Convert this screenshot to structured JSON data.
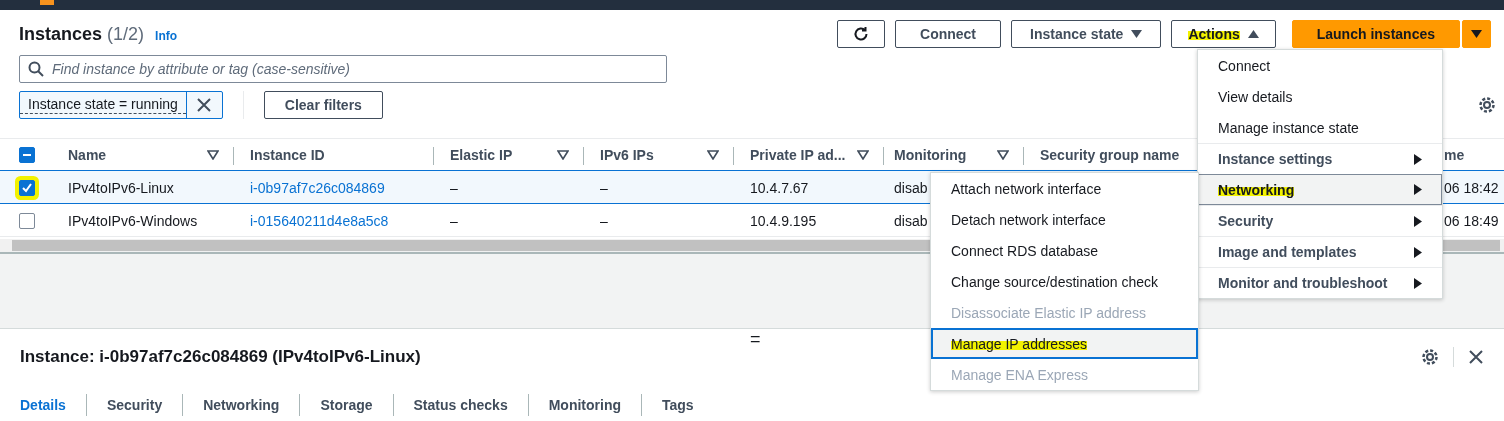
{
  "header": {
    "title": "Instances",
    "count": "(1/2)",
    "info": "Info"
  },
  "toolbar": {
    "connect": "Connect",
    "instance_state": "Instance state",
    "actions": {
      "label": "Actions",
      "expanded": true,
      "highlighted": true
    },
    "launch": "Launch instances"
  },
  "search": {
    "placeholder": "Find instance by attribute or tag (case-sensitive)"
  },
  "filter": {
    "token": "Instance state = running"
  },
  "clear_filters": "Clear filters",
  "table": {
    "select_all": {
      "indeterminate": true
    },
    "columns": [
      {
        "label": "Name",
        "filter_icon": true,
        "kind": "text"
      },
      {
        "label": "Instance ID",
        "filter_icon": false,
        "kind": "link"
      },
      {
        "label": "Elastic IP",
        "filter_icon": true,
        "kind": "text"
      },
      {
        "label": "IPv6 IPs",
        "filter_icon": true,
        "kind": "text"
      },
      {
        "label": "Private IP ad...",
        "filter_icon": true,
        "kind": "text"
      },
      {
        "label": "Monitoring",
        "filter_icon": true,
        "kind": "text"
      },
      {
        "label": "Security group name",
        "filter_icon": false,
        "kind": "covered"
      },
      {
        "label": "me",
        "filter_icon": false,
        "kind": "text"
      }
    ],
    "rows": [
      {
        "selected": true,
        "highlighted": true,
        "cells": [
          "IPv4toIPv6-Linux",
          "i-0b97af7c26c084869",
          "–",
          "–",
          "10.4.7.67",
          "disab",
          "06 18:42"
        ]
      },
      {
        "selected": false,
        "highlighted": false,
        "cells": [
          "IPv4toIPv6-Windows",
          "i-015640211d4e8a5c8",
          "–",
          "–",
          "10.4.9.195",
          "disab",
          "06 18:49"
        ]
      }
    ]
  },
  "actions_menu": [
    {
      "label": "Connect",
      "kind": "action",
      "selected": false,
      "highlighted": false
    },
    {
      "label": "View details",
      "kind": "action",
      "selected": false,
      "highlighted": false
    },
    {
      "label": "Manage instance state",
      "kind": "action",
      "selected": false,
      "highlighted": false
    },
    {
      "label": "Instance settings",
      "kind": "submenu",
      "selected": false,
      "highlighted": false
    },
    {
      "label": "Networking",
      "kind": "submenu",
      "selected": true,
      "highlighted": true
    },
    {
      "label": "Security",
      "kind": "submenu",
      "selected": false,
      "highlighted": false
    },
    {
      "label": "Image and templates",
      "kind": "submenu",
      "selected": false,
      "highlighted": false
    },
    {
      "label": "Monitor and troubleshoot",
      "kind": "submenu",
      "selected": false,
      "highlighted": false
    }
  ],
  "networking_menu": [
    {
      "label": "Attach network interface",
      "disabled": false,
      "selected": false,
      "highlighted": false
    },
    {
      "label": "Detach network interface",
      "disabled": false,
      "selected": false,
      "highlighted": false
    },
    {
      "label": "Connect RDS database",
      "disabled": false,
      "selected": false,
      "highlighted": false
    },
    {
      "label": "Change source/destination check",
      "disabled": false,
      "selected": false,
      "highlighted": false
    },
    {
      "label": "Disassociate Elastic IP address",
      "disabled": true,
      "selected": false,
      "highlighted": false
    },
    {
      "label": "Manage IP addresses",
      "disabled": false,
      "selected": true,
      "highlighted": true
    },
    {
      "label": "Manage ENA Express",
      "disabled": true,
      "selected": false,
      "highlighted": false
    }
  ],
  "splitter": "=",
  "detail": {
    "title": "Instance: i-0b97af7c26c084869 (IPv4toIPv6-Linux)",
    "tabs": [
      {
        "label": "Details",
        "selected": true
      },
      {
        "label": "Security",
        "selected": false
      },
      {
        "label": "Networking",
        "selected": false
      },
      {
        "label": "Storage",
        "selected": false
      },
      {
        "label": "Status checks",
        "selected": false
      },
      {
        "label": "Monitoring",
        "selected": false
      },
      {
        "label": "Tags",
        "selected": false
      }
    ]
  }
}
